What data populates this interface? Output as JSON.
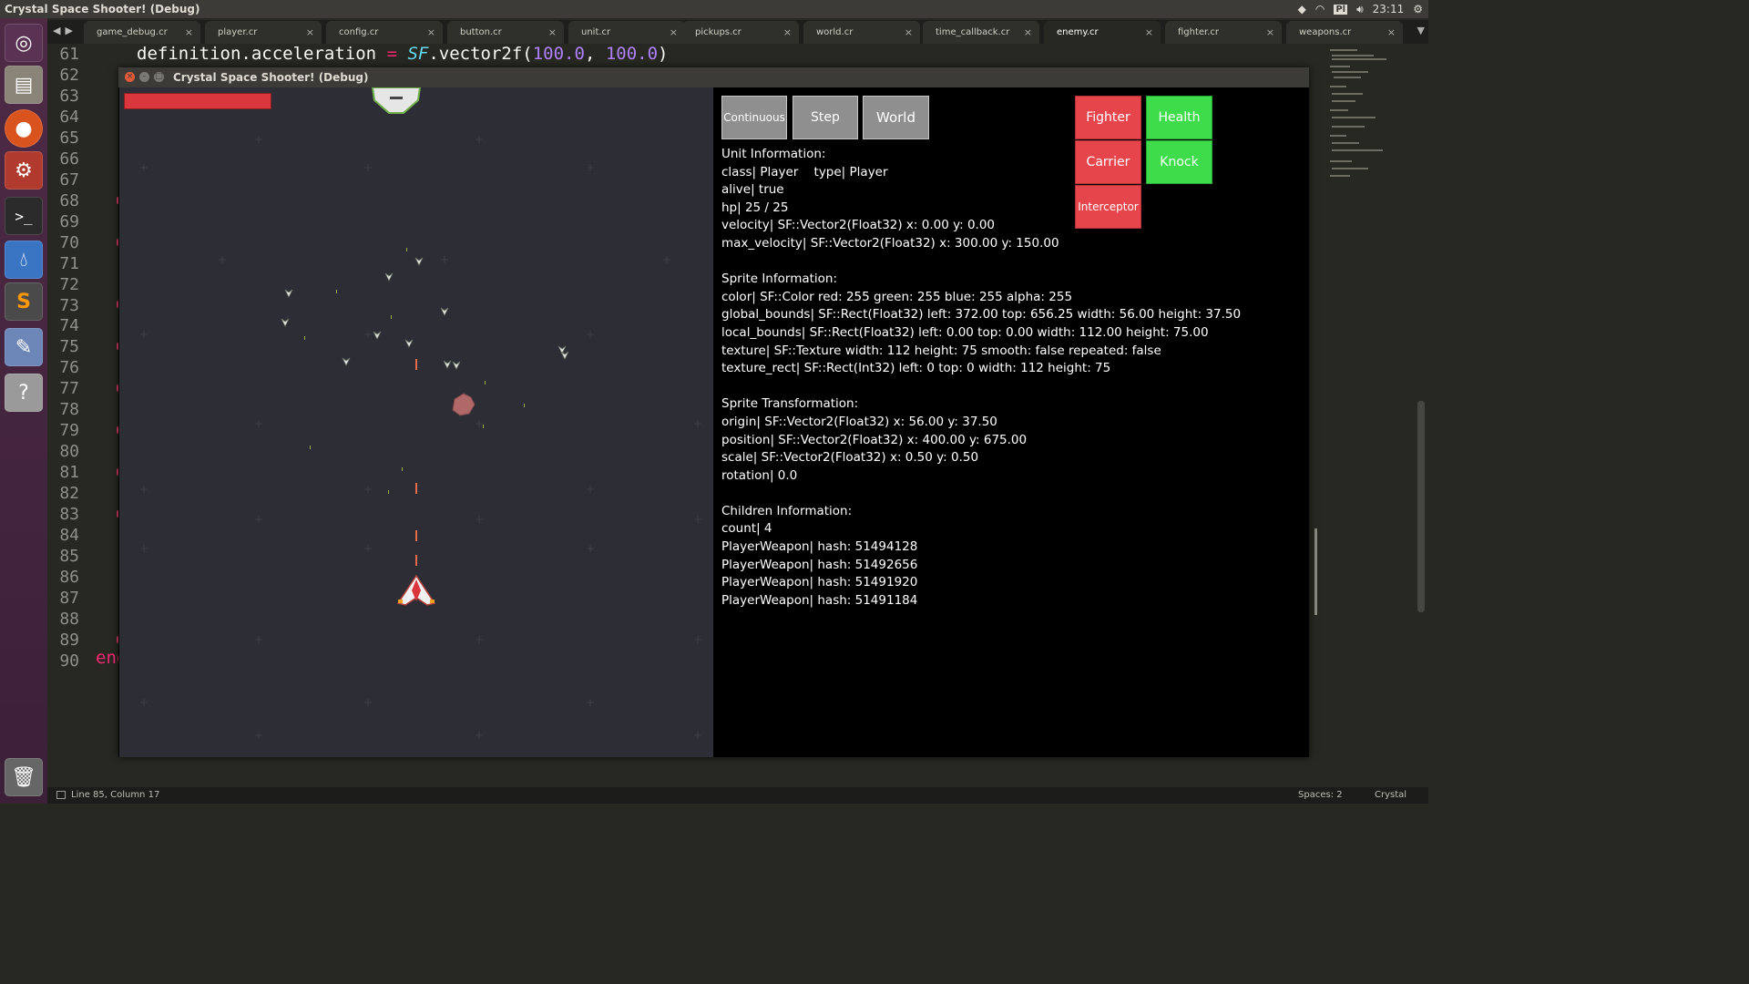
{
  "os": {
    "window_title": "Crystal Space Shooter! (Debug)",
    "clock": "23:11",
    "keyboard_indicator": "Pl"
  },
  "launcher": {
    "items": [
      "ubuntu-dash",
      "files",
      "firefox",
      "system-settings",
      "terminal",
      "drop-app",
      "sublime-text",
      "paint-app",
      "help",
      "trash"
    ]
  },
  "editor": {
    "tabs": [
      {
        "label": "game_debug.cr",
        "active": false
      },
      {
        "label": "player.cr",
        "active": false
      },
      {
        "label": "config.cr",
        "active": false
      },
      {
        "label": "button.cr",
        "active": false
      },
      {
        "label": "unit.cr",
        "active": false
      },
      {
        "label": "pickups.cr",
        "active": false
      },
      {
        "label": "world.cr",
        "active": false
      },
      {
        "label": "time_callback.cr",
        "active": false
      },
      {
        "label": "enemy.cr",
        "active": true
      },
      {
        "label": "fighter.cr",
        "active": false
      },
      {
        "label": "weapons.cr",
        "active": false
      }
    ],
    "line_numbers": [
      "61",
      "62",
      "63",
      "64",
      "65",
      "66",
      "67",
      "68",
      "69",
      "70",
      "71",
      "72",
      "73",
      "74",
      "75",
      "76",
      "77",
      "78",
      "79",
      "80",
      "81",
      "82",
      "83",
      "84",
      "85",
      "86",
      "87",
      "88",
      "89",
      "90"
    ],
    "code_line": {
      "object": "definition",
      "dot": ".",
      "attr": "acceleration",
      "op": " = ",
      "cls": "SF",
      "method": ".vector2f(",
      "arg1": "100.0",
      "comma": ", ",
      "arg2": "100.0",
      "close": ")"
    },
    "end_keyword": "end",
    "status": {
      "position": "Line 85, Column 17",
      "spaces": "Spaces: 2",
      "syntax": "Crystal"
    }
  },
  "game": {
    "title": "Crystal Space Shooter! (Debug)",
    "player_health": 1.0,
    "buttons": {
      "continuous": "Continuous",
      "step": "Step",
      "world": "World",
      "fighter": "Fighter",
      "carrier": "Carrier",
      "interceptor": "Interceptor",
      "health": "Health",
      "knock": "Knock"
    },
    "unit_info": {
      "heading": "Unit Information:",
      "class_line": "class| Player    type| Player",
      "alive_line": "alive| true",
      "hp_line": "hp| 25 / 25",
      "velocity_line": "velocity| SF::Vector2(Float32) x: 0.00 y: 0.00",
      "max_velocity_line": "max_velocity| SF::Vector2(Float32) x: 300.00 y: 150.00"
    },
    "sprite_info": {
      "heading": "Sprite Information:",
      "color_line": "color| SF::Color red: 255 green: 255 blue: 255 alpha: 255",
      "global_bounds_line": "global_bounds| SF::Rect(Float32) left: 372.00 top: 656.25 width: 56.00 height: 37.50",
      "local_bounds_line": "local_bounds| SF::Rect(Float32) left: 0.00 top: 0.00 width: 112.00 height: 75.00",
      "texture_line": "texture| SF::Texture width: 112 height: 75 smooth: false repeated: false",
      "texture_rect_line": "texture_rect| SF::Rect(Int32) left: 0 top: 0 width: 112 height: 75"
    },
    "transform_info": {
      "heading": "Sprite Transformation:",
      "origin_line": "origin| SF::Vector2(Float32) x: 56.00 y: 37.50",
      "position_line": "position| SF::Vector2(Float32) x: 400.00 y: 675.00",
      "scale_line": "scale| SF::Vector2(Float32) x: 0.50 y: 0.50",
      "rotation_line": "rotation| 0.0"
    },
    "children_info": {
      "heading": "Children Information:",
      "count_line": "count| 4",
      "children": [
        "PlayerWeapon| hash: 51494128",
        "PlayerWeapon| hash: 51492656",
        "PlayerWeapon| hash: 51491920",
        "PlayerWeapon| hash: 51491184"
      ]
    }
  }
}
